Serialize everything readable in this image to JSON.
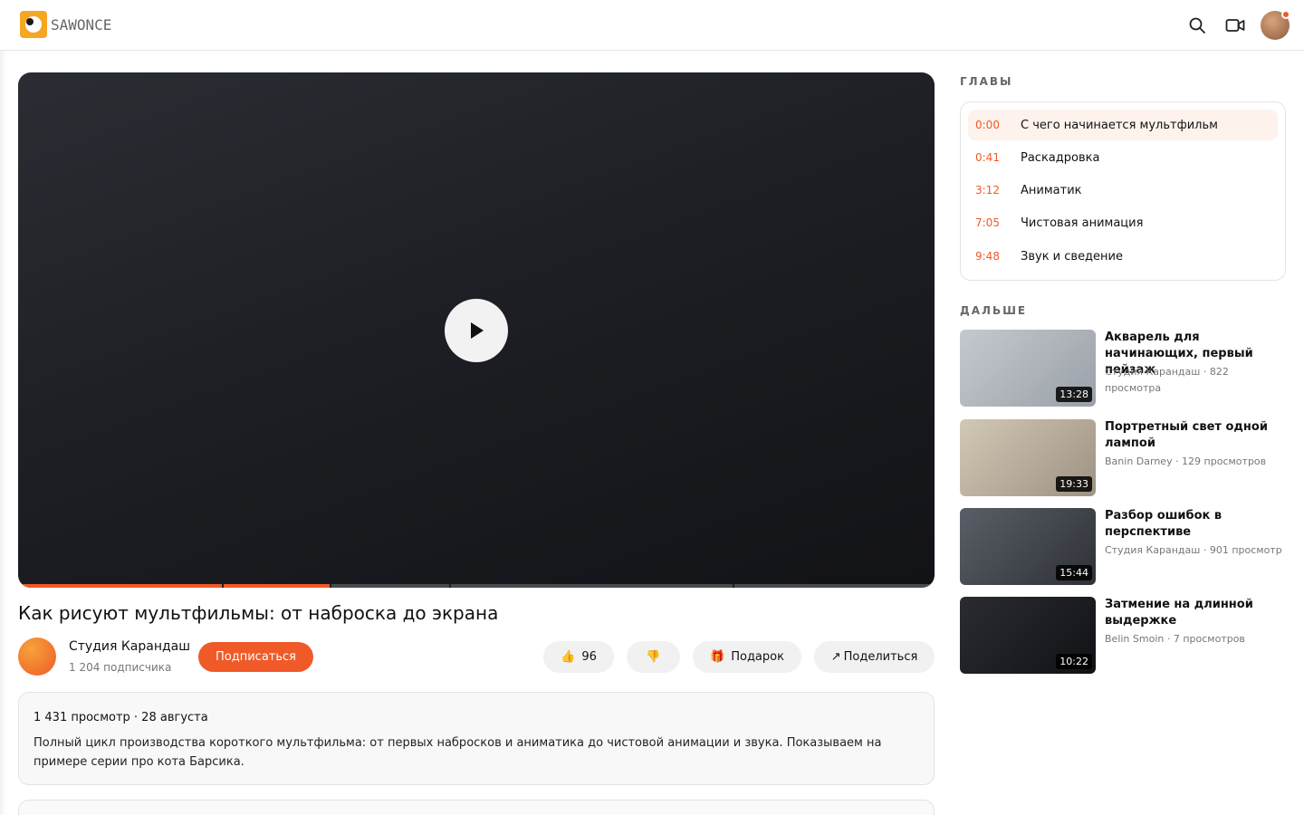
{
  "header": {
    "logo_text": "SAWONCE",
    "search_icon": "search-icon",
    "camera_icon": "video-camera-icon",
    "accent_color": "#f05a28"
  },
  "player": {
    "progress": 0.34,
    "chapter_marks": [
      0.222,
      0.34,
      0.47,
      0.78
    ]
  },
  "video": {
    "title": "Как рисуют мультфильмы: от наброска до экрана",
    "channel_name": "Студия Карандаш",
    "channel_subs": "1 204 подписчика",
    "subscribe_label": "Подписаться",
    "like_icon": "👍",
    "likes": "96",
    "dislike_icon": "👎",
    "gift_icon": "🎁",
    "gift_label": "Подарок",
    "share_icon": "↗",
    "share_label": "Поделиться",
    "meta": "1 431 просмотр · 28 августа",
    "description": "Полный цикл производства короткого мультфильма: от первых набросков и аниматика до чистовой анимации и звука. Показываем на примере серии про кота Барсика."
  },
  "sidebar": {
    "chapters_label": "ГЛАВЫ",
    "next_label": "ДАЛЬШЕ",
    "chapters": [
      {
        "time": "0:00",
        "title": "С чего начинается мультфильм"
      },
      {
        "time": "0:41",
        "title": "Раскадровка"
      },
      {
        "time": "3:12",
        "title": "Аниматик"
      },
      {
        "time": "7:05",
        "title": "Чистовая анимация"
      },
      {
        "time": "9:48",
        "title": "Звук и сведение"
      }
    ],
    "recommendations": [
      {
        "title": "Акварель для начинающих, первый пейзаж",
        "meta": "Студия Карандаш · 822 просмотра",
        "duration": "13:28"
      },
      {
        "title": "Портретный свет одной лампой",
        "meta": "Banin Darney · 129 просмотров",
        "duration": "19:33"
      },
      {
        "title": "Разбор ошибок в перспективе",
        "meta": "Студия Карандаш · 901 просмотр",
        "duration": "15:44"
      },
      {
        "title": "Затмение на длинной выдержке",
        "meta": "Belin Smoin · 7 просмотров",
        "duration": "10:22"
      }
    ]
  }
}
